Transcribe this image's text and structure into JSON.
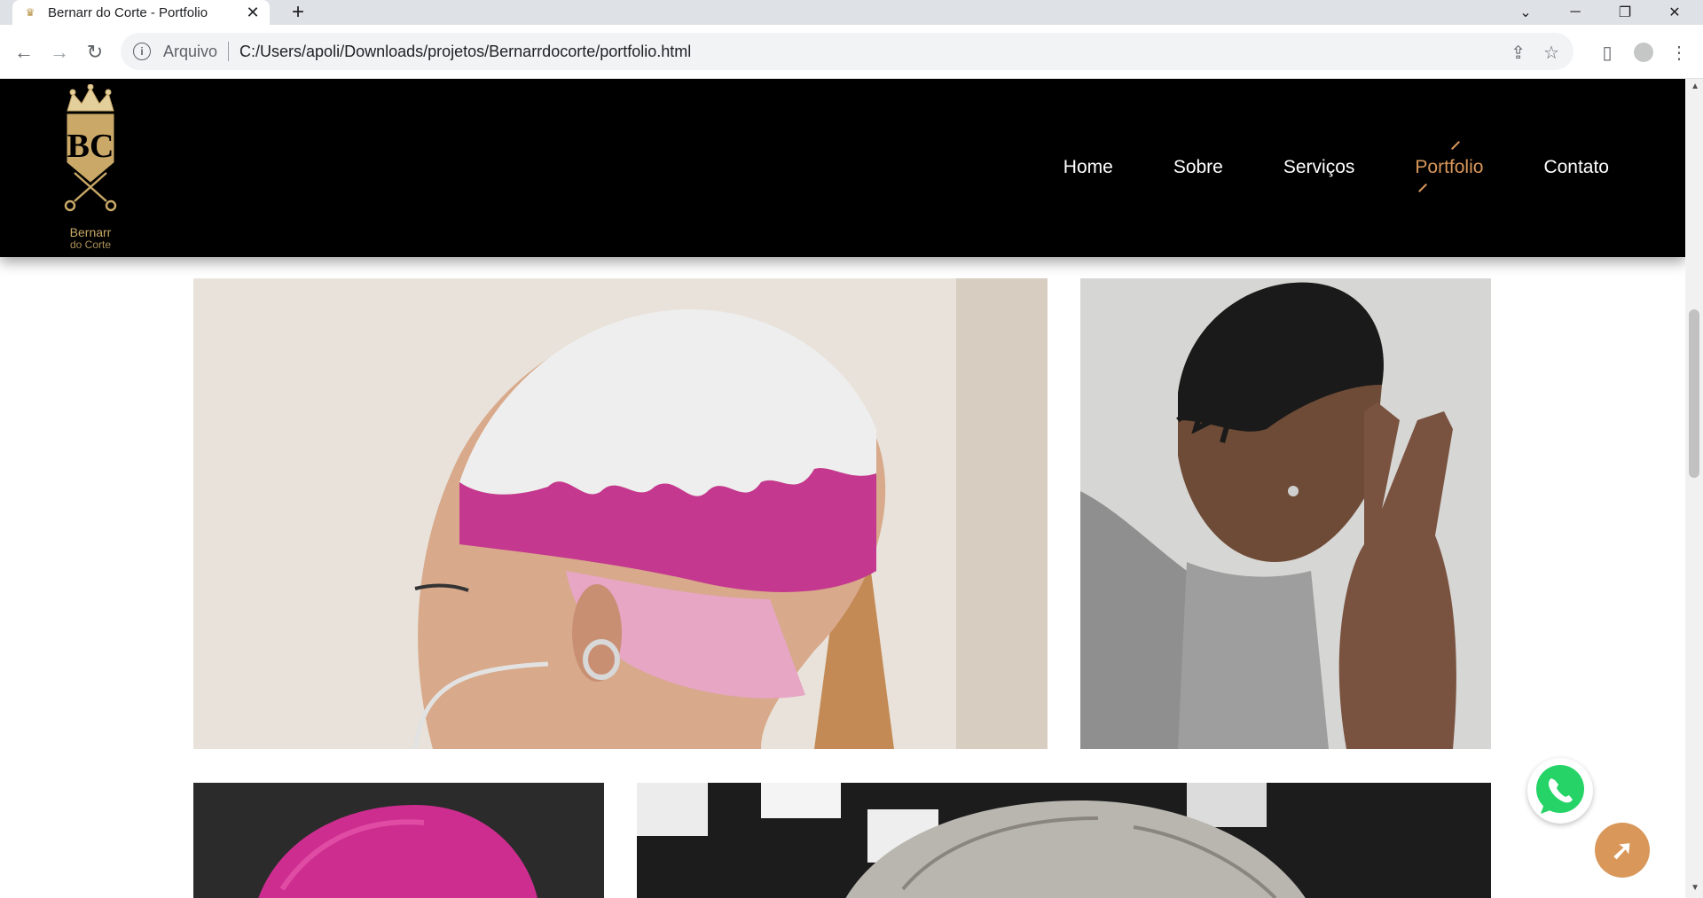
{
  "browser": {
    "tab_title": "Bernarr do Corte - Portfolio",
    "tab_close": "✕",
    "new_tab": "+",
    "address_scheme": "Arquivo",
    "address_url": "C:/Users/apoli/Downloads/projetos/Bernarrdocorte/portfolio.html"
  },
  "site": {
    "logo_line1": "Bernarr",
    "logo_line2": "do Corte",
    "logo_monogram": "BC",
    "nav": [
      "Home",
      "Sobre",
      "Serviços",
      "Portfolio",
      "Contato"
    ],
    "active_nav": "Portfolio",
    "accent_color": "#d9975a"
  },
  "portfolio": {
    "photos": [
      "fade-pink-flames",
      "fade-design-lines",
      "pink-hair",
      "platinum-hair"
    ]
  },
  "floating": {
    "whatsapp_icon": "whatsapp-icon",
    "back_to_top_icon": "arrow-up-icon"
  }
}
